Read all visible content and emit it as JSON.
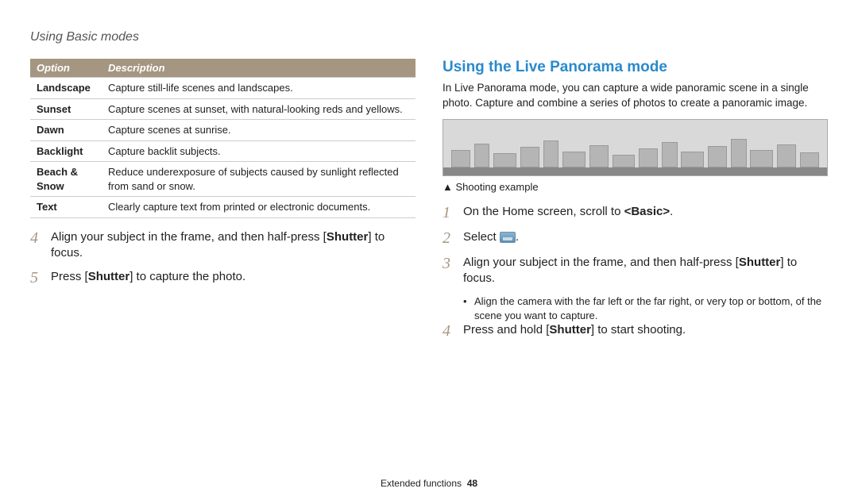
{
  "header": {
    "title": "Using Basic modes"
  },
  "table": {
    "head": {
      "option": "Option",
      "description": "Description"
    },
    "rows": [
      {
        "opt": "Landscape",
        "desc": "Capture still-life scenes and landscapes."
      },
      {
        "opt": "Sunset",
        "desc": "Capture scenes at sunset, with natural-looking reds and yellows."
      },
      {
        "opt": "Dawn",
        "desc": "Capture scenes at sunrise."
      },
      {
        "opt": "Backlight",
        "desc": "Capture backlit subjects."
      },
      {
        "opt": "Beach & Snow",
        "desc": "Reduce underexposure of subjects caused by sunlight reflected from sand or snow."
      },
      {
        "opt": "Text",
        "desc": "Clearly capture text from printed or electronic documents."
      }
    ]
  },
  "left_steps": {
    "s4": {
      "num": "4",
      "pre": "Align your subject in the frame, and then half-press [",
      "bold": "Shutter",
      "post": "] to focus."
    },
    "s5": {
      "num": "5",
      "pre": "Press [",
      "bold": "Shutter",
      "post": "] to capture the photo."
    }
  },
  "right": {
    "title": "Using the Live Panorama mode",
    "intro": "In Live Panorama mode, you can capture a wide panoramic scene in a single photo. Capture and combine a series of photos to create a panoramic image.",
    "caption_tri": "▲",
    "caption": "Shooting example",
    "s1": {
      "num": "1",
      "pre": "On the Home screen, scroll to ",
      "bold": "<Basic>",
      "post": "."
    },
    "s2": {
      "num": "2",
      "pre": "Select ",
      "post": "."
    },
    "s3": {
      "num": "3",
      "pre": "Align your subject in the frame, and then half-press [",
      "bold": "Shutter",
      "post": "] to focus."
    },
    "s3_bullet": "Align the camera with the far left or the far right, or very top or bottom, of the scene you want to capture.",
    "s4": {
      "num": "4",
      "pre": "Press and hold [",
      "bold": "Shutter",
      "post": "] to start shooting."
    }
  },
  "footer": {
    "section": "Extended functions",
    "page": "48"
  }
}
